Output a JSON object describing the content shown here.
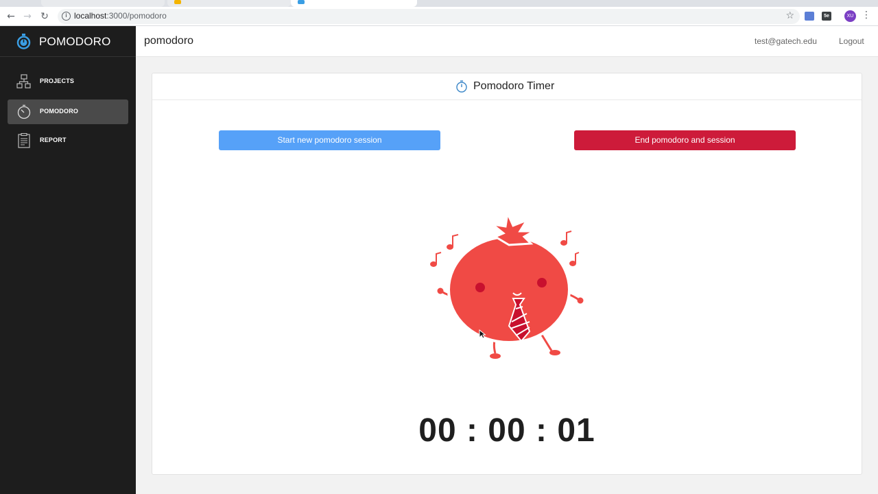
{
  "browser": {
    "url_host": "localhost",
    "url_path": ":3000/pomodoro",
    "profile_initials": "XU",
    "extension_label": "5e",
    "back_icon": "back-arrow-icon",
    "forward_icon": "forward-arrow-icon",
    "reload_icon": "reload-icon"
  },
  "sidebar": {
    "brand": "POMODORO",
    "items": [
      {
        "label": "PROJECTS",
        "icon": "projects-icon",
        "active": false
      },
      {
        "label": "POMODORO",
        "icon": "stopwatch-icon",
        "active": true
      },
      {
        "label": "REPORT",
        "icon": "report-icon",
        "active": false
      }
    ]
  },
  "header": {
    "title": "pomodoro",
    "user_email": "test@gatech.edu",
    "logout_label": "Logout"
  },
  "card": {
    "title": "Pomodoro Timer",
    "start_button": "Start new pomodoro session",
    "end_button": "End pomodoro and session",
    "timer": "00 : 00 : 01",
    "illustration": "dancing-tomato"
  },
  "colors": {
    "sidebar_bg": "#1d1d1d",
    "start_button": "#56a1f8",
    "end_button": "#cd1b3a",
    "tomato": "#f04a45",
    "brand_icon": "#3a9ee4"
  }
}
